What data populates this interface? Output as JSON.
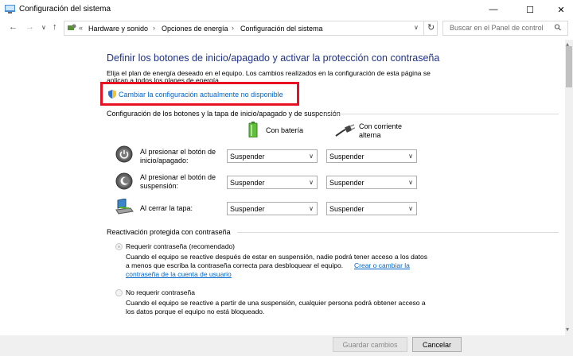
{
  "window": {
    "title": "Configuración del sistema",
    "controls": {
      "minimize": "—",
      "maximize": "☐",
      "close": "✕"
    }
  },
  "nav": {
    "back": "←",
    "forward": "→",
    "down": "∨",
    "up": "↑",
    "refresh": "↻",
    "crumb_overflow": "«",
    "breadcrumb": [
      "Hardware y sonido",
      "Opciones de energía",
      "Configuración del sistema"
    ],
    "dropdown": "∨",
    "search_placeholder": "Buscar en el Panel de control",
    "search_icon": "⚲"
  },
  "main": {
    "heading": "Definir los botones de inicio/apagado y activar la protección con contraseña",
    "desc_line1": "Elija el plan de energía deseado en el equipo. Los cambios realizados en la configuración de esta página se",
    "desc_line2": "aplican a todos los planes de energía.",
    "change_link": "Cambiar la configuración actualmente no disponible"
  },
  "buttons_section": {
    "title": "Configuración de los botones y la tapa de inicio/apagado y de suspensión",
    "col_battery": "Con batería",
    "col_ac": "Con corriente alterna",
    "rows": [
      {
        "label": "Al presionar el botón de inicio/apagado:",
        "battery": "Suspender",
        "ac": "Suspender"
      },
      {
        "label": "Al presionar el botón de suspensión:",
        "battery": "Suspender",
        "ac": "Suspender"
      },
      {
        "label": "Al cerrar la tapa:",
        "battery": "Suspender",
        "ac": "Suspender"
      }
    ],
    "chevron": "∨"
  },
  "password_section": {
    "title": "Reactivación protegida con contraseña",
    "require_label": "Requerir contraseña (recomendado)",
    "require_desc1": "Cuando el equipo se reactive después de estar en suspensión, nadie podrá tener acceso a los datos",
    "require_desc2": "a menos que escriba la contraseña correcta para desbloquear el equipo.",
    "require_link1": "Crear o cambiar la",
    "require_link2": "contraseña de la cuenta de usuario",
    "norequire_label": "No requerir contraseña",
    "norequire_desc1": "Cuando el equipo se reactive a partir de una suspensión, cualquier persona podrá obtener acceso a",
    "norequire_desc2": "los datos porque el equipo no está bloqueado."
  },
  "footer": {
    "save": "Guardar cambios",
    "cancel": "Cancelar"
  },
  "scroll": {
    "up": "▴",
    "down": "▾"
  }
}
